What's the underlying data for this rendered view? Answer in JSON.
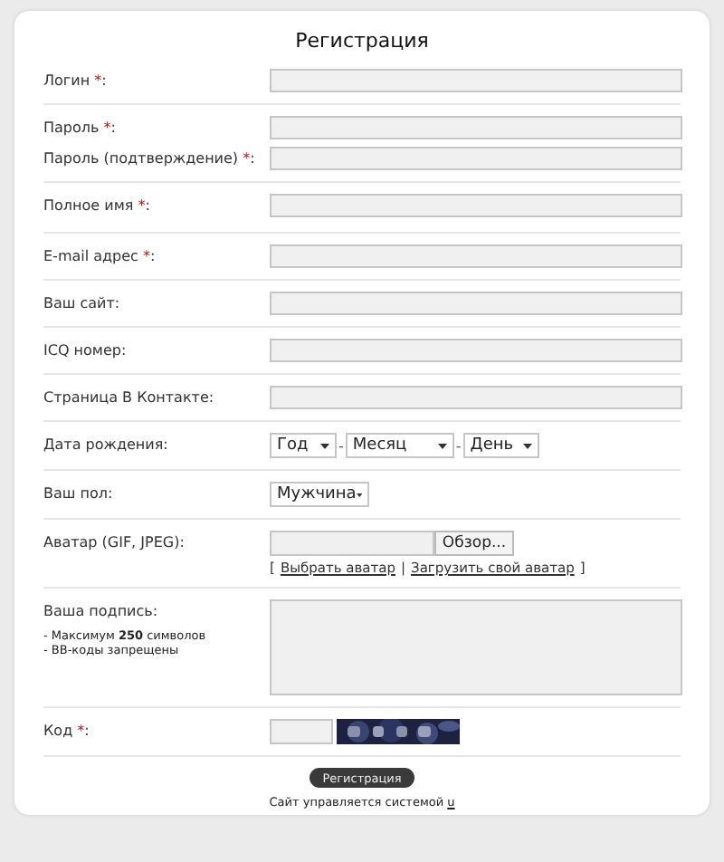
{
  "title": "Регистрация",
  "sections": [
    {
      "rows": [
        {
          "kind": "text",
          "label": "Логин",
          "asterisk": "*",
          "end": ":"
        }
      ]
    },
    {
      "rows": [
        {
          "kind": "text",
          "label": "Пароль",
          "asterisk": "*",
          "end": ":"
        },
        {
          "kind": "text",
          "label": "Пароль (подтверждение)",
          "asterisk": "*",
          "end": ":"
        }
      ]
    },
    {
      "rows": [
        {
          "kind": "text",
          "label": "Полное имя",
          "asterisk": "*",
          "end": ":"
        }
      ]
    },
    {
      "rows": [
        {
          "kind": "text",
          "label": "E-mail адрес",
          "asterisk": "*",
          "end": ":"
        }
      ]
    },
    {
      "rows": [
        {
          "kind": "text",
          "label": "Ваш сайт:"
        }
      ]
    },
    {
      "rows": [
        {
          "kind": "text",
          "label": "ICQ номер:"
        }
      ]
    },
    {
      "rows": [
        {
          "kind": "text",
          "label": "Страница В Контакте:"
        }
      ]
    },
    {
      "rows": [
        {
          "kind": "date",
          "label": "Дата рождения:",
          "selects": [
            "Год",
            "Месяц",
            "День"
          ],
          "separators": [
            "-",
            "-"
          ]
        }
      ]
    },
    {
      "rows": [
        {
          "kind": "select",
          "label": "Ваш пол:",
          "value": "Мужчина"
        }
      ]
    },
    {
      "rows": [
        {
          "kind": "file",
          "label": "Аватар (GIF, JPEG):",
          "button": "Обзор...",
          "links": [
            {
              "kind": "bracket",
              "text": "["
            },
            {
              "kind": "link",
              "text": "Выбрать аватар"
            },
            {
              "kind": "bracket",
              "text": "|"
            },
            {
              "kind": "link",
              "text": "Загрузить свой аватар"
            },
            {
              "kind": "bracket",
              "text": "]"
            }
          ]
        }
      ]
    },
    {
      "rows": [
        {
          "kind": "textarea",
          "label": "Ваша подпись:",
          "notes": [
            "- Максимум **250** символов",
            "- BB-коды запрещены"
          ]
        }
      ]
    },
    {
      "rows": [
        {
          "kind": "captcha",
          "label": "Код",
          "asterisk": "*",
          "end": ":"
        }
      ]
    }
  ],
  "submit": "Регистрация",
  "footer": {
    "text": "Сайт управляется системой",
    "link": "u"
  }
}
